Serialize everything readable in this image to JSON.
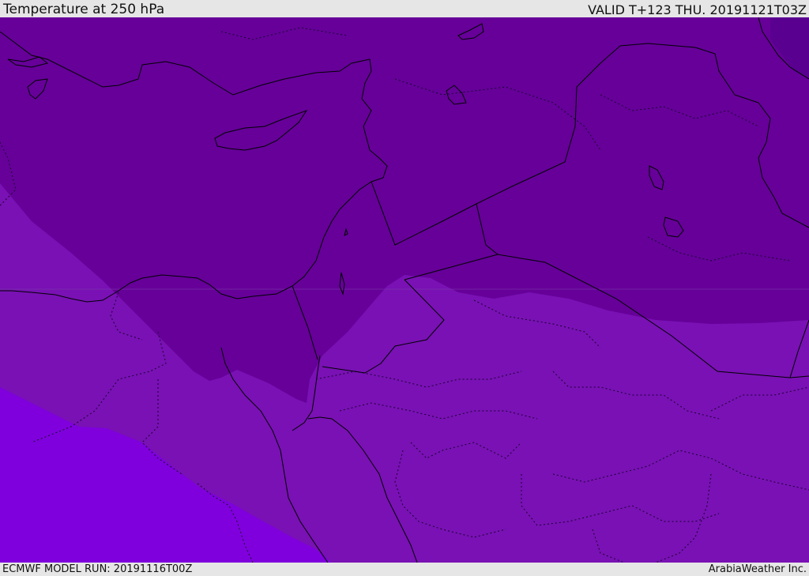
{
  "header": {
    "title": "Temperature at 250 hPa",
    "valid_time": "VALID T+123 THU. 20191121T03Z"
  },
  "footer": {
    "model_run": "ECMWF MODEL RUN: 20191116T00Z",
    "credit": "ArabiaWeather Inc."
  },
  "map": {
    "colors": {
      "darkest_band": "#5a0090",
      "dark_band": "#660099",
      "mid_band": "#7911b4",
      "light_band": "#7f00dc",
      "coastline": "#000000",
      "border": "#000000"
    }
  }
}
